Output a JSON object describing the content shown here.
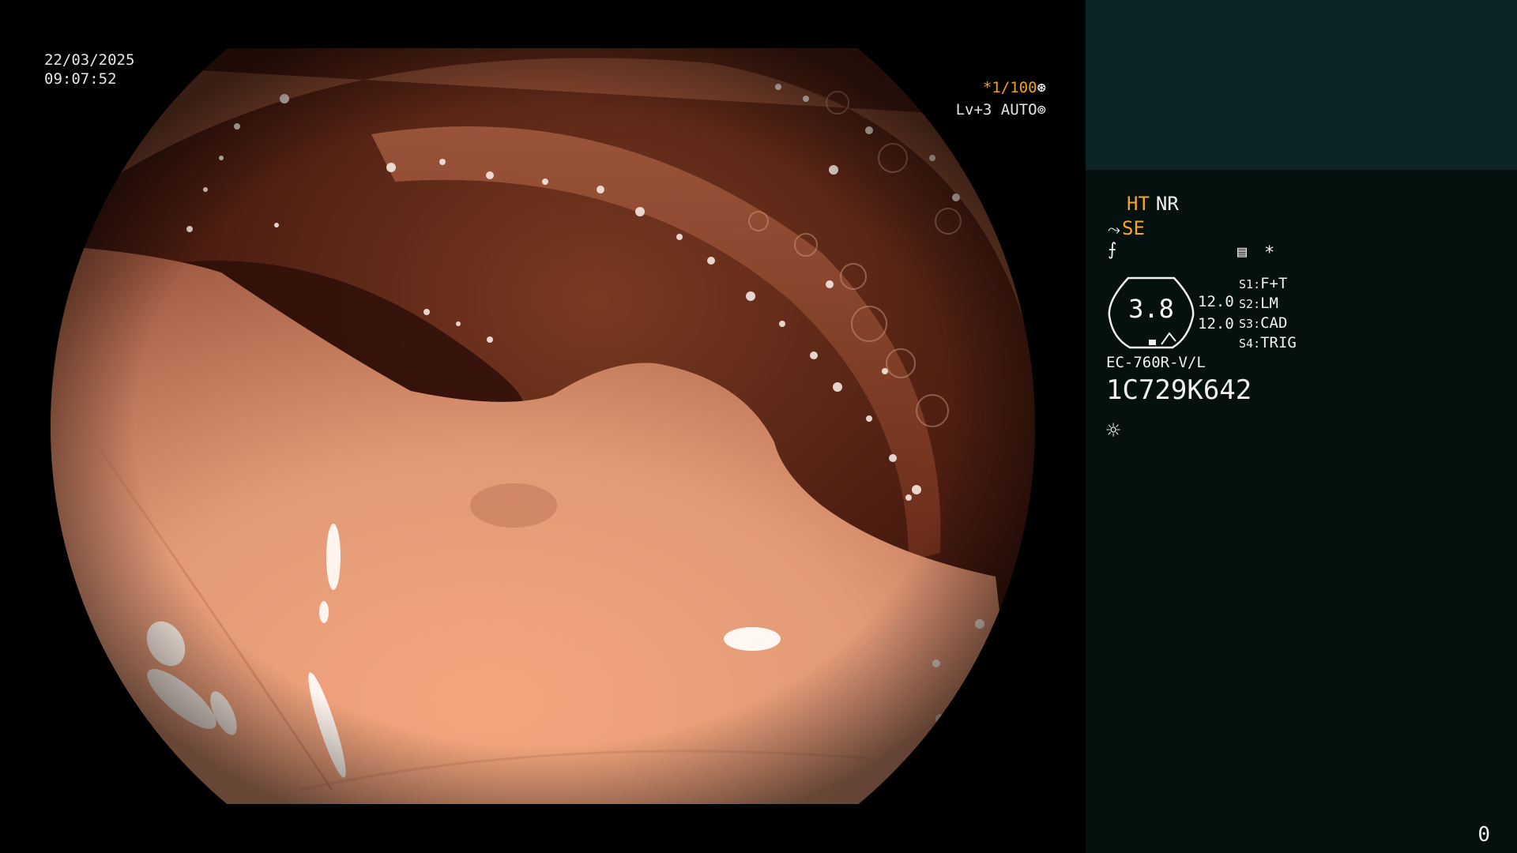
{
  "overlay": {
    "date": "22/03/2025",
    "time": "09:07:52",
    "shutter_speed": "*1/100",
    "shutter_icon": "aperture-icon",
    "brightness_level": "Lv+3",
    "iris_mode": "AUTO",
    "iris_icon": "iris-icon"
  },
  "panel": {
    "enhance_ht": "HT",
    "noise_reduction": "NR",
    "structure_enhance": "SE",
    "structure_icon": "scope-angle-icon",
    "gamma_icon": "curve-icon",
    "settings_icon": "menu-icon",
    "star": "*",
    "gauge_value": "3.8",
    "sat_values": [
      "12.0",
      "12.0"
    ],
    "switches": [
      {
        "key": "S1",
        "value": "F+T"
      },
      {
        "key": "S2",
        "value": "LM"
      },
      {
        "key": "S3",
        "value": "CAD"
      },
      {
        "key": "S4",
        "value": "TRIG"
      }
    ],
    "scope_model": "EC-760R-V/L",
    "scope_serial": "1C729K642",
    "light_icon": "brightness-icon",
    "counter": "0"
  },
  "colors": {
    "accent_orange": "#f5a623",
    "panel_bg": "#04110f",
    "panel_top_bg": "#0d2425"
  }
}
